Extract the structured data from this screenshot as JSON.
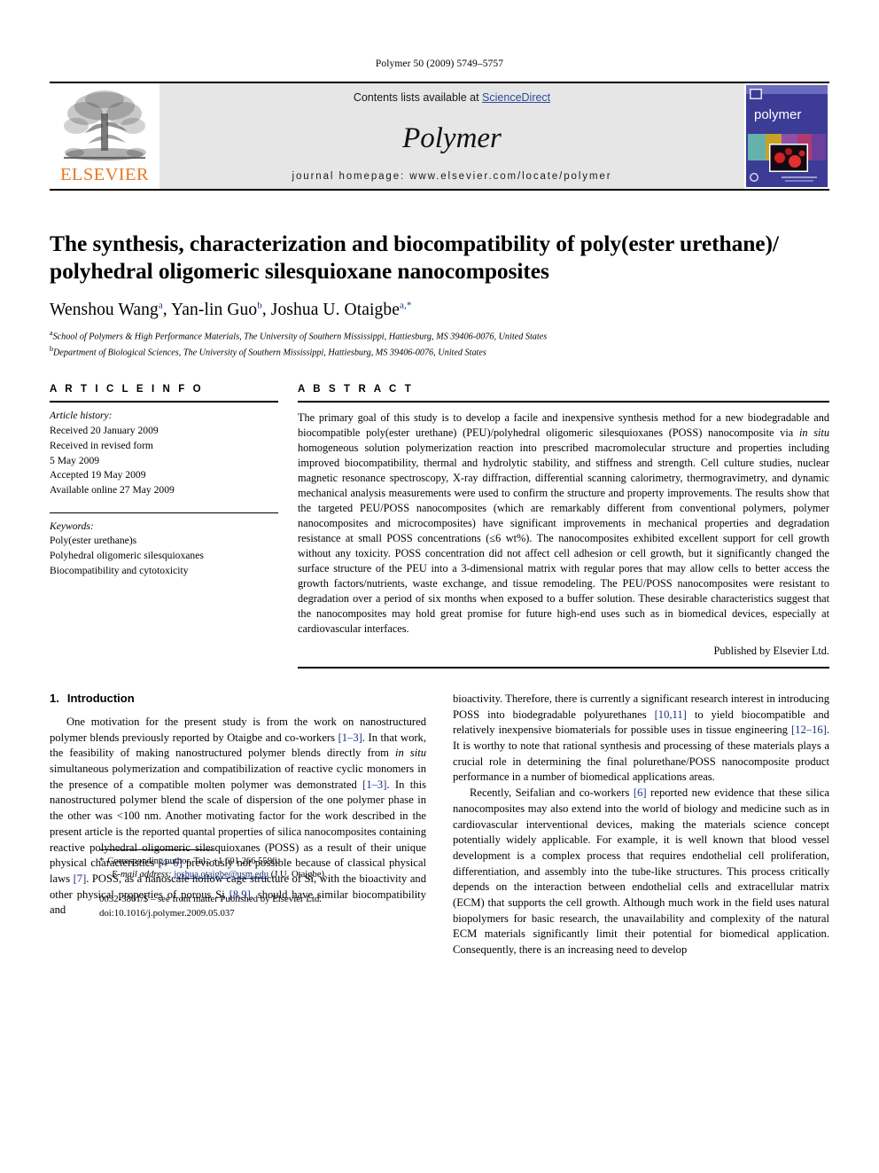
{
  "running_head": "Polymer 50 (2009) 5749–5757",
  "banner": {
    "publisher_name": "ELSEVIER",
    "contents_prefix": "Contents lists available at ",
    "sciencedirect": "ScienceDirect",
    "journal_name": "Polymer",
    "homepage": "journal homepage: www.elsevier.com/locate/polymer",
    "cover_title": "polymer",
    "accent_orange": "#E87722",
    "link_blue": "#2b4c9b",
    "banner_gray": "#e6e6e6"
  },
  "article": {
    "title": "The synthesis, characterization and biocompatibility of poly(ester urethane)/ polyhedral oligomeric silesquioxane nanocomposites",
    "authors": [
      {
        "name": "Wenshou Wang",
        "marks": "a"
      },
      {
        "name": "Yan-lin Guo",
        "marks": "b"
      },
      {
        "name": "Joshua U. Otaigbe",
        "marks": "a,*"
      }
    ],
    "affiliations": [
      {
        "mark": "a",
        "text": "School of Polymers & High Performance Materials, The University of Southern Mississippi, Hattiesburg, MS 39406-0076, United States"
      },
      {
        "mark": "b",
        "text": "Department of Biological Sciences, The University of Southern Mississippi, Hattiesburg, MS 39406-0076, United States"
      }
    ]
  },
  "info": {
    "heading": "A R T I C L E  I N F O",
    "history_label": "Article history:",
    "history": [
      "Received 20 January 2009",
      "Received in revised form",
      "5 May 2009",
      "Accepted 19 May 2009",
      "Available online 27 May 2009"
    ],
    "keywords_label": "Keywords:",
    "keywords": [
      "Poly(ester urethane)s",
      "Polyhedral oligomeric silesquioxanes",
      "Biocompatibility and cytotoxicity"
    ]
  },
  "abstract": {
    "heading": "A B S T R A C T",
    "part1": "The primary goal of this study is to develop a facile and inexpensive synthesis method for a new biodegradable and biocompatible poly(ester urethane) (PEU)/polyhedral oligomeric silesquioxanes (POSS) nanocomposite via ",
    "insitu": "in situ",
    "part2": " homogeneous solution polymerization reaction into prescribed macromolecular structure and properties including improved biocompatibility, thermal and hydrolytic stability, and stiffness and strength. Cell culture studies, nuclear magnetic resonance spectroscopy, X-ray diffraction, differential scanning calorimetry, thermogravimetry, and dynamic mechanical analysis measurements were used to confirm the structure and property improvements. The results show that the targeted PEU/POSS nanocomposites (which are remarkably different from conventional polymers, polymer nanocomposites and microcomposites) have significant improvements in mechanical properties and degradation resistance at small POSS concentrations (≤6 wt%). The nanocomposites exhibited excellent support for cell growth without any toxicity. POSS concentration did not affect cell adhesion or cell growth, but it significantly changed the surface structure of the PEU into a 3-dimensional matrix with regular pores that may allow cells to better access the growth factors/nutrients, waste exchange, and tissue remodeling. The PEU/POSS nanocomposites were resistant to degradation over a period of six months when exposed to a buffer solution. These desirable characteristics suggest that the nanocomposites may hold great promise for future high-end uses such as in biomedical devices, especially at cardiovascular interfaces.",
    "published_by": "Published by Elsevier Ltd."
  },
  "introduction": {
    "number": "1.",
    "title": "Introduction",
    "left_p1_a": "One motivation for the present study is from the work on nanostructured polymer blends previously reported by Otaigbe and co-workers ",
    "left_ref1": "[1–3]",
    "left_p1_b": ". In that work, the feasibility of making nanostructured polymer blends directly from ",
    "left_insitu": "in situ",
    "left_p1_c": " simultaneous polymerization and compatibilization of reactive cyclic monomers in the presence of a compatible molten polymer was demonstrated ",
    "left_ref2": "[1–3]",
    "left_p1_d": ". In this nanostructured polymer blend the scale of dispersion of the one polymer phase in the other was <100 nm. Another motivating factor for the work described in the present article is the reported quantal properties of silica nanocomposites containing reactive polyhedral oligomeric silesquioxanes (POSS) as a result of their unique physical characteristics ",
    "left_ref3": "[4–6]",
    "left_p1_e": " previously not possible because of classical physical laws ",
    "left_ref4": "[7]",
    "left_p1_f": ". POSS, as a nanoscale hollow cage structure of Si, with the bioactivity and other physical properties of porous Si ",
    "left_ref5": "[8,9]",
    "left_p1_g": ", should have similar biocompatibility and",
    "right_p1_a": "bioactivity. Therefore, there is currently a significant research interest in introducing POSS into biodegradable polyurethanes ",
    "right_ref1": "[10,11]",
    "right_p1_b": " to yield biocompatible and relatively inexpensive biomaterials for possible uses in tissue engineering ",
    "right_ref2": "[12–16]",
    "right_p1_c": ". It is worthy to note that rational synthesis and processing of these materials plays a crucial role in determining the final polurethane/POSS nanocomposite product performance in a number of biomedical applications areas.",
    "right_p2_a": "Recently, Seifalian and co-workers ",
    "right_ref3": "[6]",
    "right_p2_b": " reported new evidence that these silica nanocomposites may also extend into the world of biology and medicine such as in cardiovascular interventional devices, making the materials science concept potentially widely applicable. For example, it is well known that blood vessel development is a complex process that requires endothelial cell proliferation, differentiation, and assembly into the tube-like structures. This process critically depends on the interaction between endothelial cells and extracellular matrix (ECM) that supports the cell growth. Although much work in the field uses natural biopolymers for basic research, the unavailability and complexity of the natural ECM materials significantly limit their potential for biomedical application. Consequently, there is an increasing need to develop"
  },
  "footnote": {
    "star": "*",
    "corresponding": "Corresponding author. Tel.: +1 601 266 5596.",
    "email_label": "E-mail address:",
    "email": "joshua.otaigbe@usm.edu",
    "email_suffix": "(J.U. Otaigbe)."
  },
  "imprint": {
    "line1": "0032-3861/$ – see front matter Published by Elsevier Ltd.",
    "line2": "doi:10.1016/j.polymer.2009.05.037"
  }
}
